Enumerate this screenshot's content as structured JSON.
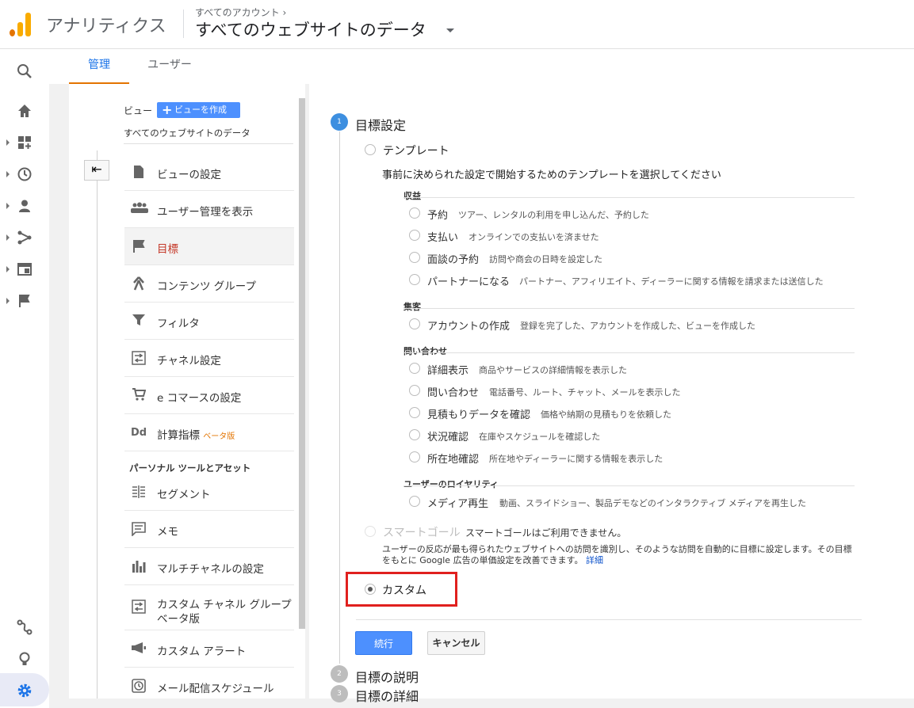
{
  "header": {
    "app_title": "アナリティクス",
    "breadcrumb": "すべてのアカウント ›",
    "property": "すべてのウェブサイトのデータ"
  },
  "tabs": [
    {
      "label": "管理",
      "active": true
    },
    {
      "label": "ユーザー",
      "active": false
    }
  ],
  "view": {
    "label": "ビュー",
    "create_label": "ビューを作成",
    "name": "すべてのウェブサイトのデータ"
  },
  "nav": {
    "items": [
      {
        "label": "ビューの設定",
        "icon": "document-icon"
      },
      {
        "label": "ユーザー管理を表示",
        "icon": "users-icon"
      },
      {
        "label": "目標",
        "icon": "flag-icon",
        "active": true
      },
      {
        "label": "コンテンツ グループ",
        "icon": "content-group-icon"
      },
      {
        "label": "フィルタ",
        "icon": "filter-icon"
      },
      {
        "label": "チャネル設定",
        "icon": "channel-icon"
      },
      {
        "label": "e コマースの設定",
        "icon": "cart-icon"
      },
      {
        "label": "計算指標",
        "icon": "dd-icon",
        "beta": "ベータ版"
      }
    ],
    "section_title": "パーソナル ツールとアセット",
    "personal_items": [
      {
        "label": "セグメント",
        "icon": "segment-icon"
      },
      {
        "label": "メモ",
        "icon": "memo-icon"
      },
      {
        "label": "マルチチャネルの設定",
        "icon": "bar-chart-icon"
      },
      {
        "label": "カスタム チャネル グループ",
        "icon": "channel-icon",
        "beta": "ベータ版"
      },
      {
        "label": "カスタム アラート",
        "icon": "megaphone-icon"
      },
      {
        "label": "メール配信スケジュール",
        "icon": "clock-icon"
      }
    ]
  },
  "goal": {
    "step1_title": "目標設定",
    "step2_title": "目標の説明",
    "step3_title": "目標の詳細",
    "step1_num": "1",
    "step2_num": "2",
    "step3_num": "3",
    "template_label": "テンプレート",
    "template_desc": "事前に決められた設定で開始するためのテンプレートを選択してください",
    "categories": [
      {
        "title": "収益",
        "items": [
          {
            "label": "予約",
            "desc": "ツアー、レンタルの利用を申し込んだ、予約した"
          },
          {
            "label": "支払い",
            "desc": "オンラインでの支払いを済ませた"
          },
          {
            "label": "面談の予約",
            "desc": "訪問や商会の日時を設定した"
          },
          {
            "label": "パートナーになる",
            "desc": "パートナー、アフィリエイト、ディーラーに関する情報を請求または送信した"
          }
        ]
      },
      {
        "title": "集客",
        "items": [
          {
            "label": "アカウントの作成",
            "desc": "登録を完了した、アカウントを作成した、ビューを作成した"
          }
        ]
      },
      {
        "title": "問い合わせ",
        "items": [
          {
            "label": "詳細表示",
            "desc": "商品やサービスの詳細情報を表示した"
          },
          {
            "label": "問い合わせ",
            "desc": "電話番号、ルート、チャット、メールを表示した"
          },
          {
            "label": "見積もりデータを確認",
            "desc": "価格や納期の見積もりを依頼した"
          },
          {
            "label": "状況確認",
            "desc": "在庫やスケジュールを確認した"
          },
          {
            "label": "所在地確認",
            "desc": "所在地やディーラーに関する情報を表示した"
          }
        ]
      },
      {
        "title": "ユーザーのロイヤリティ",
        "items": [
          {
            "label": "メディア再生",
            "desc": "動画、スライドショー、製品デモなどのインタラクティブ メディアを再生した"
          }
        ]
      }
    ],
    "smart_label": "スマートゴール",
    "smart_note": "スマートゴールはご利用できません。",
    "smart_desc_1": "ユーザーの反応が最も得られたウェブサイトへの訪問を識別し、そのような訪問を自動的に目標に設定します。その目標",
    "smart_desc_2": "をもとに Google 広告の単価設定を改善できます。",
    "smart_link": "詳細",
    "custom_label": "カスタム",
    "continue_label": "続行",
    "cancel_label": "キャンセル"
  }
}
